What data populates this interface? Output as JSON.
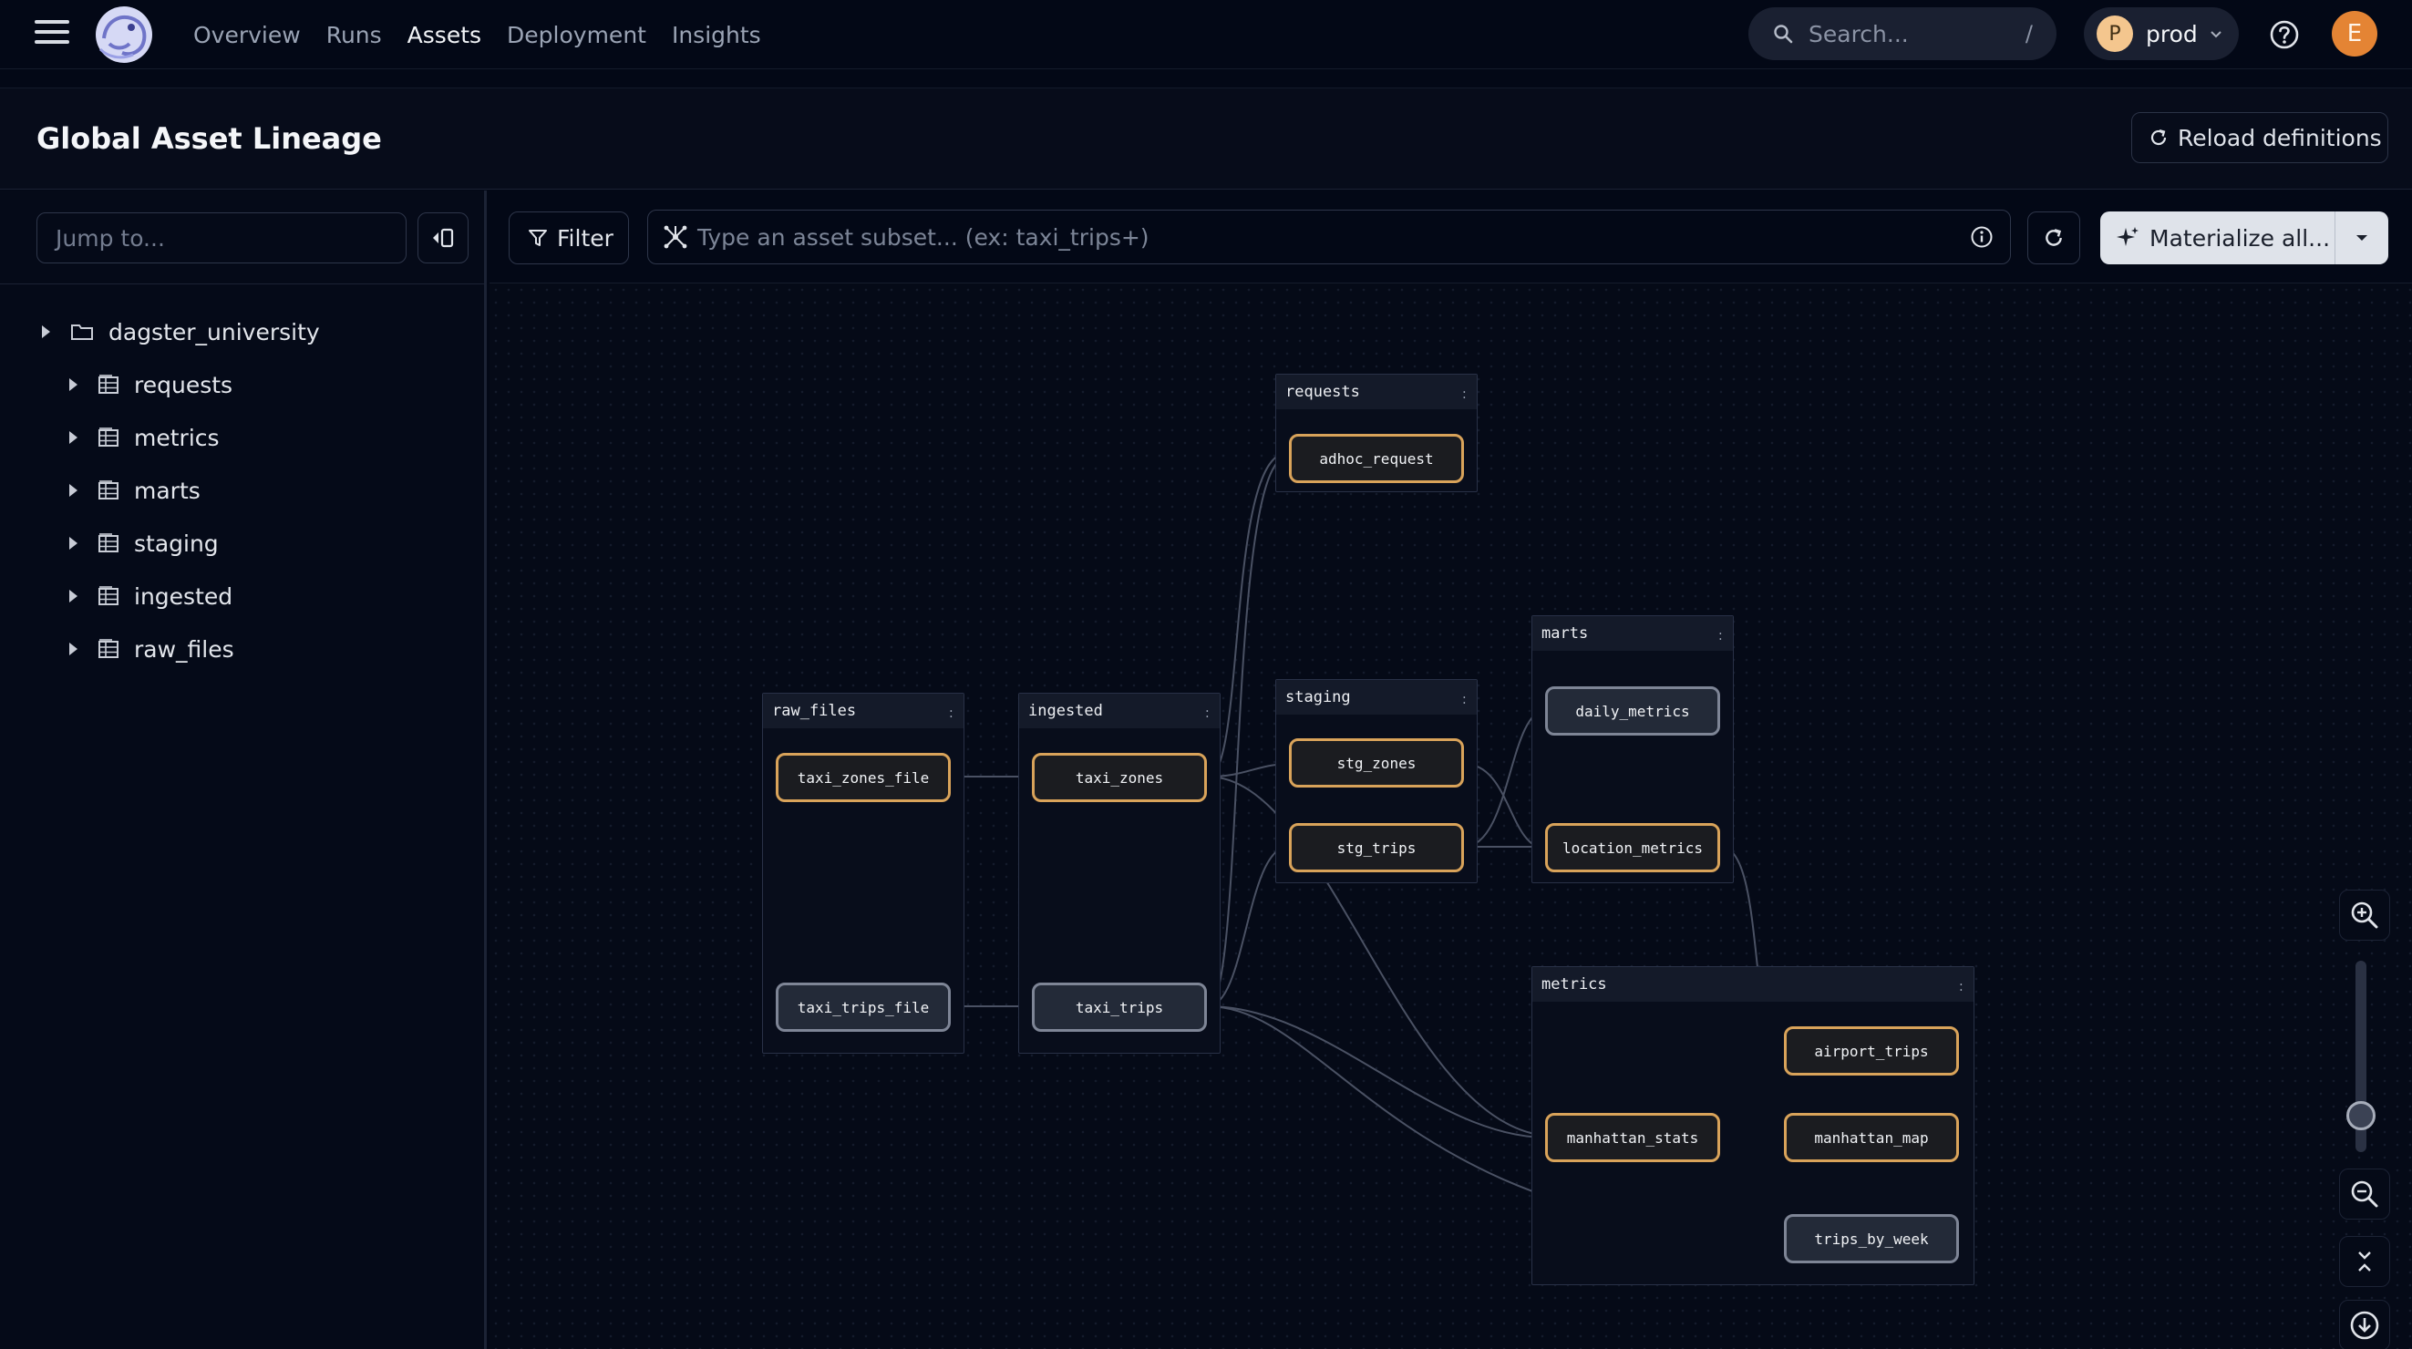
{
  "nav": {
    "links": [
      "Overview",
      "Runs",
      "Assets",
      "Deployment",
      "Insights"
    ],
    "active": "Assets",
    "search_placeholder": "Search...",
    "search_shortcut": "/",
    "deployment_initial": "P",
    "deployment_name": "prod",
    "user_initial": "E"
  },
  "header": {
    "title": "Global Asset Lineage",
    "reload_label": "Reload definitions"
  },
  "sidebar": {
    "jump_placeholder": "Jump to...",
    "root": "dagster_university",
    "groups": [
      "requests",
      "metrics",
      "marts",
      "staging",
      "ingested",
      "raw_files"
    ]
  },
  "toolbar": {
    "filter_label": "Filter",
    "subset_placeholder": "Type an asset subset... (ex: taxi_trips+)",
    "materialize_label": "Materialize all..."
  },
  "graph": {
    "groups": [
      {
        "name": "requests"
      },
      {
        "name": "raw_files"
      },
      {
        "name": "ingested"
      },
      {
        "name": "staging"
      },
      {
        "name": "marts"
      },
      {
        "name": "metrics"
      }
    ],
    "assets": [
      {
        "name": "adhoc_request",
        "group": "requests",
        "status": "materialized"
      },
      {
        "name": "taxi_zones_file",
        "group": "raw_files",
        "status": "materialized"
      },
      {
        "name": "taxi_trips_file",
        "group": "raw_files",
        "status": "never"
      },
      {
        "name": "taxi_zones",
        "group": "ingested",
        "status": "materialized"
      },
      {
        "name": "taxi_trips",
        "group": "ingested",
        "status": "never"
      },
      {
        "name": "stg_zones",
        "group": "staging",
        "status": "materialized"
      },
      {
        "name": "stg_trips",
        "group": "staging",
        "status": "materialized"
      },
      {
        "name": "daily_metrics",
        "group": "marts",
        "status": "never"
      },
      {
        "name": "location_metrics",
        "group": "marts",
        "status": "materialized"
      },
      {
        "name": "airport_trips",
        "group": "metrics",
        "status": "materialized"
      },
      {
        "name": "manhattan_stats",
        "group": "metrics",
        "status": "materialized"
      },
      {
        "name": "manhattan_map",
        "group": "metrics",
        "status": "materialized"
      },
      {
        "name": "trips_by_week",
        "group": "metrics",
        "status": "never"
      }
    ]
  },
  "colors": {
    "background": "#030816",
    "materialized_border": "#d9a35a",
    "never_border": "#7e8596",
    "edge": "#4a5163"
  }
}
